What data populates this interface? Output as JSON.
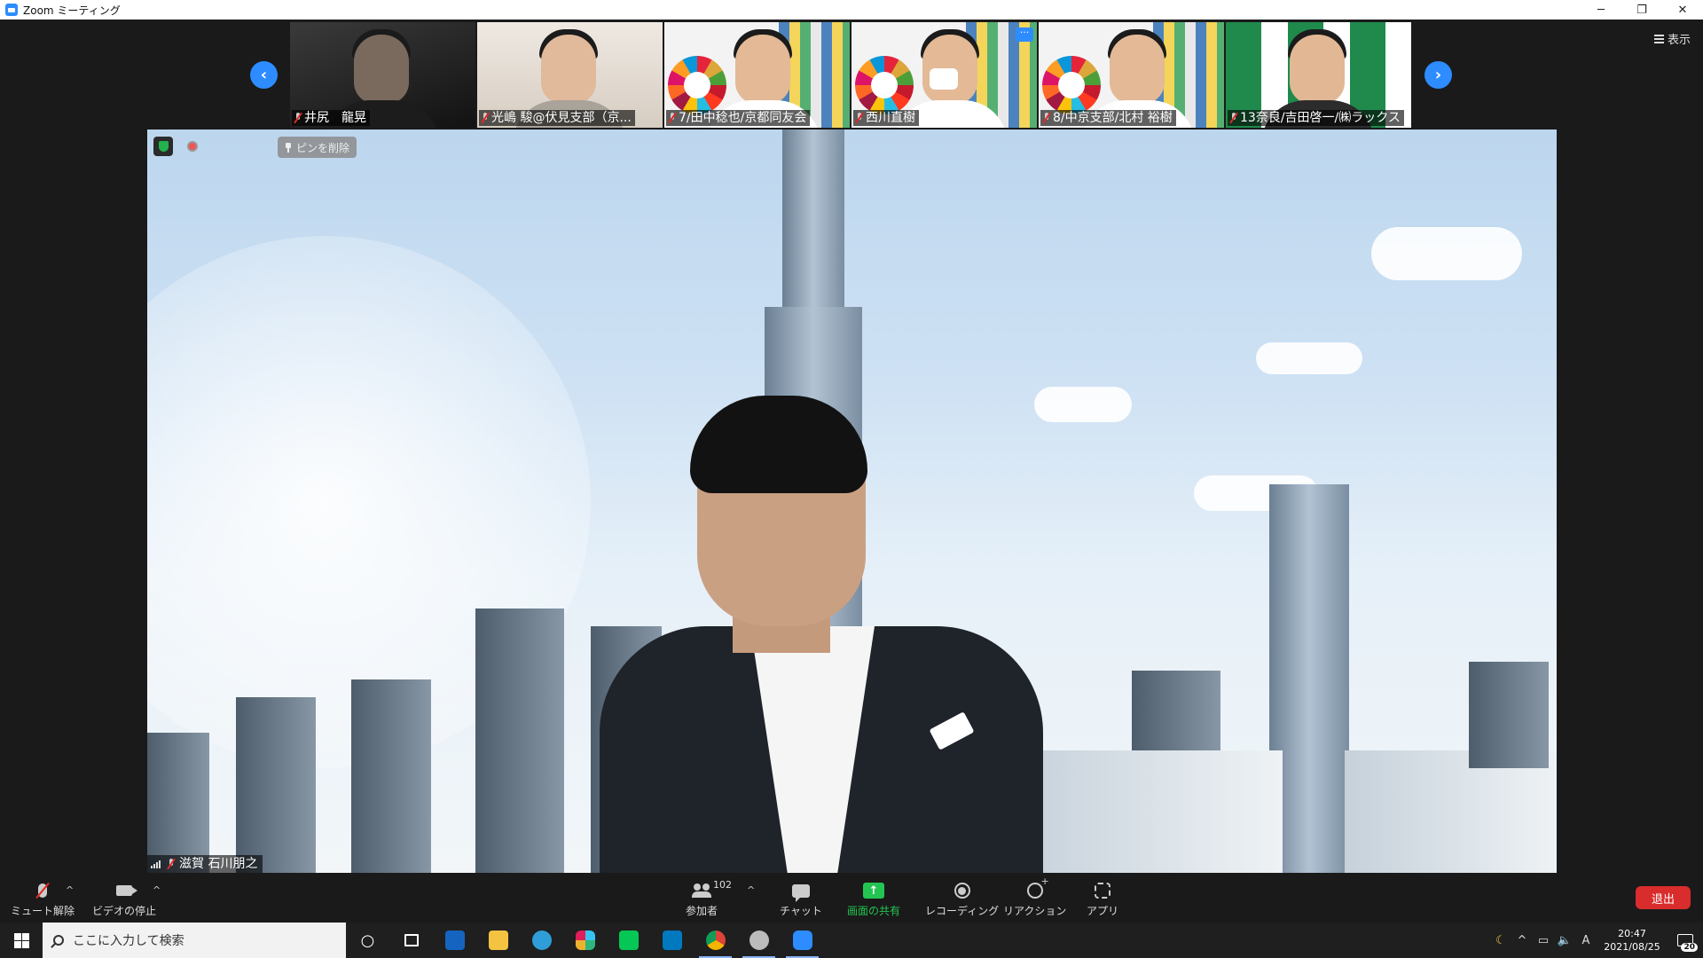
{
  "window": {
    "title": "Zoom ミーティング",
    "minimize": "─",
    "restore": "❐",
    "close": "✕"
  },
  "view_button": {
    "label": "表示"
  },
  "nav": {
    "prev": "‹",
    "next": "›"
  },
  "participants": [
    {
      "name": "井尻　龍晃"
    },
    {
      "name": "光嶋 駿@伏見支部（京..."
    },
    {
      "name": "7/田中稔也/京都同友会"
    },
    {
      "name": "西川直樹"
    },
    {
      "name": "8/中京支部/北村 裕樹"
    },
    {
      "name": "13奈良/吉田啓一/㈱ラックス"
    }
  ],
  "participant_more": "···",
  "main_video": {
    "speaker_label": "滋賀 石川朋之",
    "unpin_label": "ピンを削除"
  },
  "toolbar": {
    "unmute": "ミュート解除",
    "stop_video": "ビデオの停止",
    "participants": "参加者",
    "participant_count": "102",
    "chat": "チャット",
    "share_screen": "画面の共有",
    "share_arrow": "↑",
    "recording": "レコーディング",
    "reactions": "リアクション",
    "apps": "アプリ",
    "leave": "退出",
    "caret": "^"
  },
  "taskbar": {
    "search_placeholder": "ここに入力して検索",
    "cortana": "○",
    "time": "20:47",
    "date": "2021/08/25",
    "notifications": "20",
    "ime": "A",
    "tray_up": "^",
    "weather": "☾",
    "volume": "🔈",
    "battery": "▭"
  },
  "colors": {
    "accent": "#2d8cff",
    "share_green": "#23c552",
    "leave_red": "#d92c2c"
  }
}
